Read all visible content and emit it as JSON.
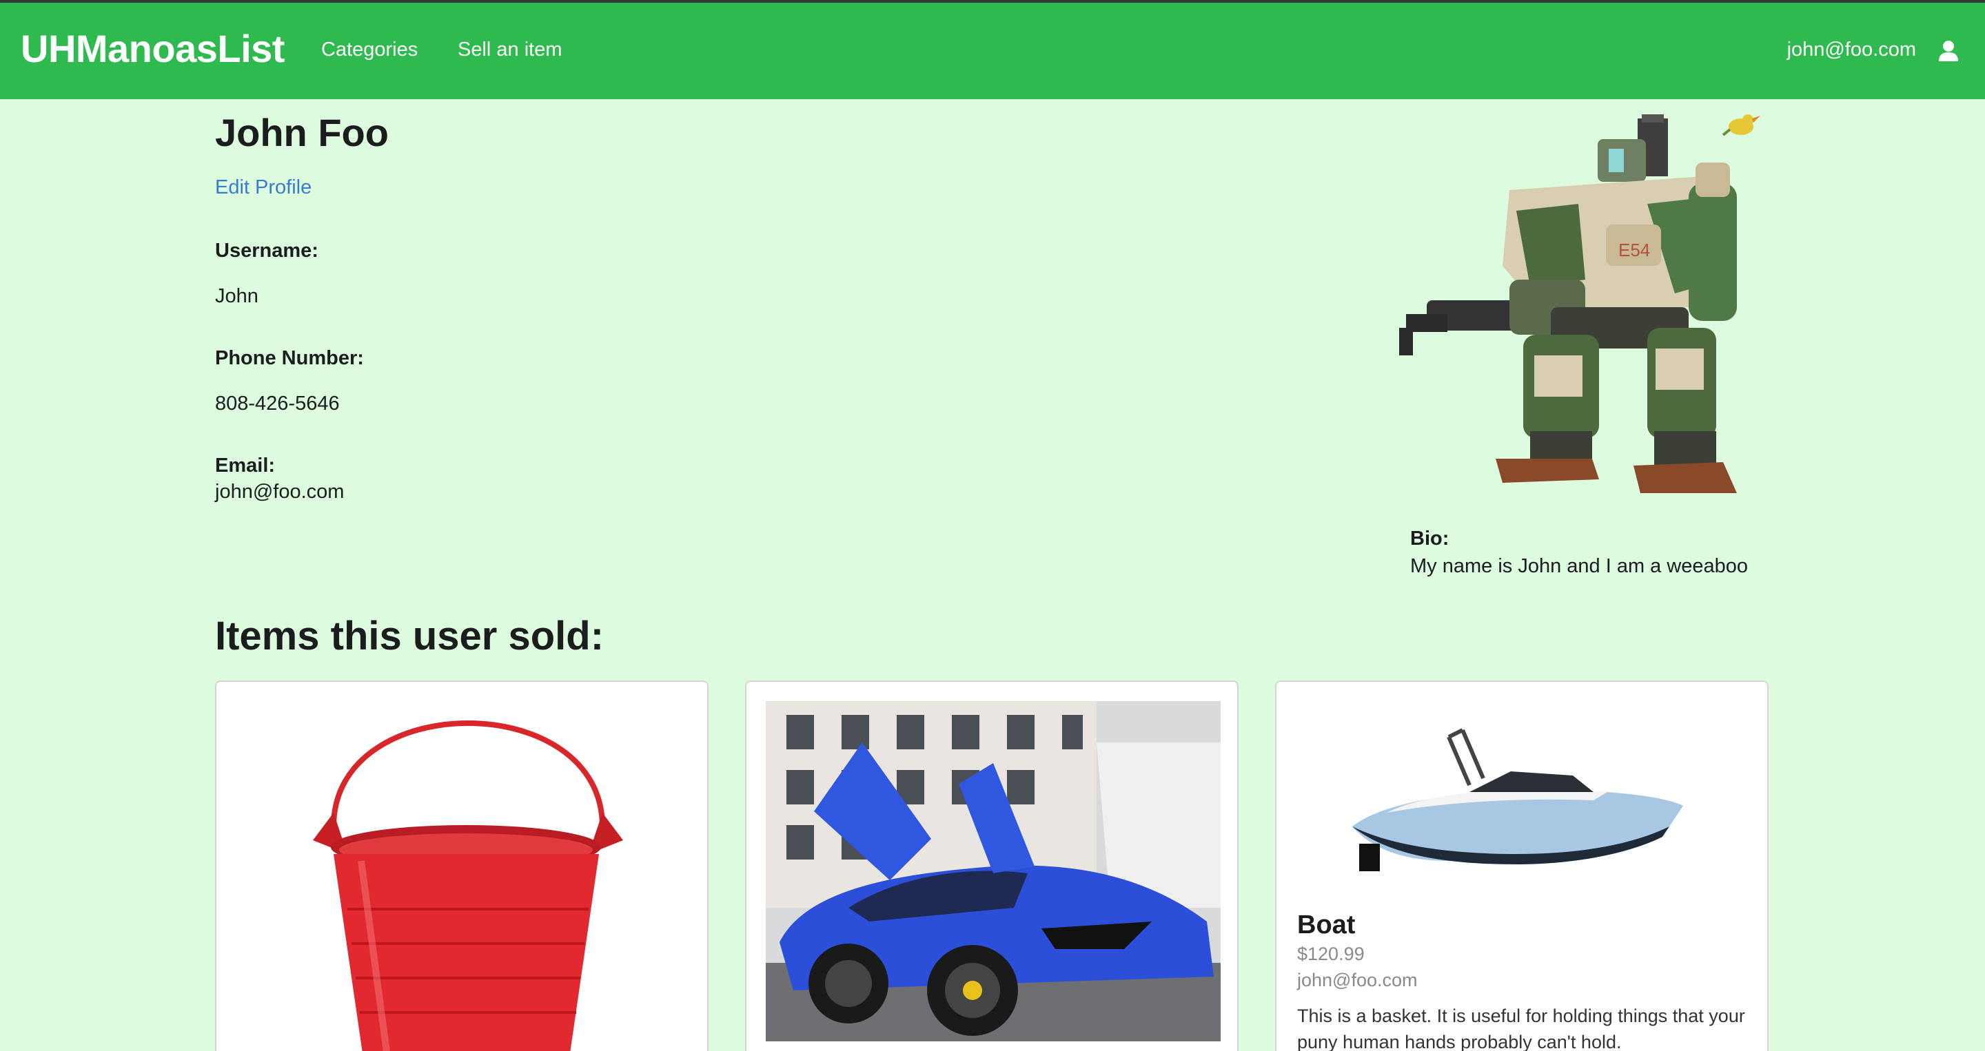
{
  "navbar": {
    "brand": "UHManoasList",
    "links": {
      "categories": "Categories",
      "sell": "Sell an item"
    },
    "user_email": "john@foo.com"
  },
  "profile": {
    "name": "John Foo",
    "edit_label": "Edit Profile",
    "username_label": "Username:",
    "username": "John",
    "phone_label": "Phone Number:",
    "phone": "808-426-5646",
    "email_label": "Email:",
    "email": "john@foo.com",
    "bio_label": "Bio:",
    "bio": "My name is John and I am a weeaboo"
  },
  "items_section": {
    "title": "Items this user sold:",
    "items": [
      {
        "image": "red-bucket"
      },
      {
        "image": "blue-sports-car"
      },
      {
        "image": "speedboat",
        "name": "Boat",
        "price": "$120.99",
        "seller": "john@foo.com",
        "description": "This is a basket. It is useful for holding things that your puny human hands probably can't hold."
      }
    ]
  },
  "colors": {
    "navbar": "#2eba4f",
    "background": "#ddfcdf",
    "link": "#3a7cc9"
  }
}
